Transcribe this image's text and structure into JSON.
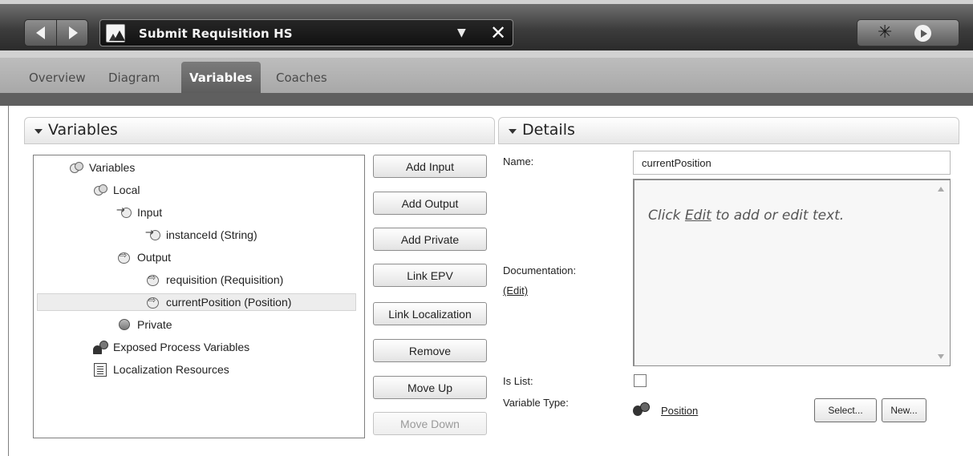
{
  "toolbar": {
    "document_title": "Submit Requisition HS",
    "dropdown_glyph": "▼",
    "close_glyph": "✕",
    "icons": [
      "back-arrow-icon",
      "forward-arrow-icon",
      "process-icon",
      "debug-bug-icon",
      "run-play-icon"
    ]
  },
  "tabs": [
    {
      "label": "Overview",
      "active": false
    },
    {
      "label": "Diagram",
      "active": false
    },
    {
      "label": "Variables",
      "active": true
    },
    {
      "label": "Coaches",
      "active": false
    }
  ],
  "variables_panel": {
    "title": "Variables",
    "tree": [
      {
        "label": "Variables",
        "icon": "variable-group-icon"
      },
      {
        "label": "Local",
        "icon": "variable-group-icon"
      },
      {
        "label": "Input",
        "icon": "input-variable-icon"
      },
      {
        "label": "instanceId (String)",
        "icon": "input-variable-icon"
      },
      {
        "label": "Output",
        "icon": "output-variable-icon"
      },
      {
        "label": "requisition (Requisition)",
        "icon": "output-variable-icon"
      },
      {
        "label": "currentPosition (Position)",
        "icon": "output-variable-icon",
        "selected": true
      },
      {
        "label": "Private",
        "icon": "private-variable-icon"
      },
      {
        "label": "Exposed Process Variables",
        "icon": "exposed-variables-icon"
      },
      {
        "label": "Localization Resources",
        "icon": "localization-icon"
      }
    ],
    "buttons": {
      "add_input": "Add Input",
      "add_output": "Add Output",
      "add_private": "Add Private",
      "link_epv": "Link EPV",
      "link_localization": "Link Localization",
      "remove": "Remove",
      "move_up": "Move Up",
      "move_down": "Move Down"
    }
  },
  "details_panel": {
    "title": "Details",
    "name_label": "Name:",
    "name_value": "currentPosition",
    "documentation_label": "Documentation:",
    "documentation_edit_link": "(Edit)",
    "documentation_hint_prefix": "Click ",
    "documentation_hint_link": "Edit",
    "documentation_hint_suffix": " to add or edit text.",
    "is_list_label": "Is List:",
    "is_list_checked": false,
    "variable_type_label": "Variable Type:",
    "variable_type_value": "Position",
    "select_button": "Select...",
    "new_button": "New..."
  }
}
